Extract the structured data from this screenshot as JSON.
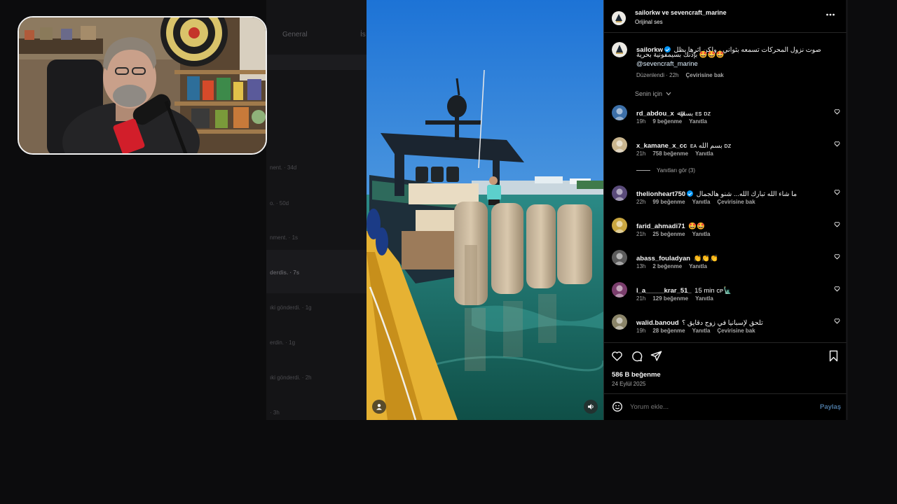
{
  "background": {
    "tabs": [
      "General",
      "İs"
    ],
    "items": [
      {
        "text": "nent. · 34d",
        "bold": false
      },
      {
        "text": "o. · 50d",
        "bold": false
      },
      {
        "text": "nment. · 1s",
        "bold": false
      },
      {
        "text": "derdis. · 7s",
        "bold": true
      },
      {
        "text": "ıki gönderdi. · 1g",
        "bold": false
      },
      {
        "text": "erdin. · 1g",
        "bold": false
      },
      {
        "text": "ıki gönderdi. · 2h",
        "bold": false
      },
      {
        "text": "· 3h",
        "bold": false
      }
    ]
  },
  "post": {
    "header": {
      "title": "sailorkw ve sevencraft_marine",
      "audio": "Orijinal ses",
      "more_icon": "more-horizontal-icon"
    },
    "caption": {
      "username": "sailorkw",
      "text_line1": "صوت نزول المحركات تسمعه بثواني ، ولكن اثرها يظل",
      "text_line2": "بإذنك بسيمفونية بحرية 🤩🤩🤩",
      "mention": "@sevencraft_marine",
      "edited": "Düzenlendi · 22h",
      "translate": "Çevirisine bak"
    },
    "sort_label": "Senin için",
    "comments": [
      {
        "username": "rd_abdou_x",
        "verified": false,
        "text": "بسمﷲ ᴇꜱ ᴅᴢ",
        "time": "19h",
        "likes": "9 beğenme",
        "reply": "Yanıtla",
        "translate": "",
        "avatar_color": "#3c6fa8"
      },
      {
        "username": "x_kamane_x_cc",
        "verified": false,
        "text": "ᴇᴀ بسم الله ᴅᴢ",
        "time": "21h",
        "likes": "758 beğenme",
        "reply": "Yanıtla",
        "translate": "",
        "avatar_color": "#c9b58e"
      },
      {
        "username": "thelionheart750",
        "verified": true,
        "text": "ما شاء الله تبارك الله... شنو هالجمال",
        "time": "22h",
        "likes": "99 beğenme",
        "reply": "Yanıtla",
        "translate": "Çevirisine bak",
        "avatar_color": "#5a4b7a"
      },
      {
        "username": "farid_ahmadi71",
        "verified": false,
        "text": "🤩🤩",
        "time": "21h",
        "likes": "25 beğenme",
        "reply": "Yanıtla",
        "translate": "",
        "avatar_color": "#c9a640"
      },
      {
        "username": "abass_fouladyan",
        "verified": false,
        "text": "👏👏👏",
        "time": "13h",
        "likes": "2 beğenme",
        "reply": "Yanıtla",
        "translate": "",
        "avatar_color": "#5b5b5b"
      },
      {
        "username": "l_a_____krar_51_",
        "verified": false,
        "text": "15 min ᴄᴘ🗽",
        "time": "21h",
        "likes": "129 beğenme",
        "reply": "Yanıtla",
        "translate": "",
        "avatar_color": "#7a3d6c"
      },
      {
        "username": "walid.banoud",
        "verified": false,
        "text": "تلحق لإسبانيا في زوج دقايق ؟",
        "time": "19h",
        "likes": "28 beğenme",
        "reply": "Yanıtla",
        "translate": "Çevirisine bak",
        "avatar_color": "#8a8468"
      }
    ],
    "view_replies": "Yanıtları gör (3)",
    "actions": {
      "like_icon": "heart-icon",
      "comment_icon": "comment-icon",
      "share_icon": "send-icon",
      "save_icon": "bookmark-icon"
    },
    "likes": "586 B beğenme",
    "date": "24 Eylül 2025",
    "comment_placeholder": "Yorum ekle...",
    "post_button": "Paylaş"
  },
  "colors": {
    "accent": "#0095f6",
    "panel_bg": "#000000",
    "secondary_text": "#a8a8a8"
  }
}
